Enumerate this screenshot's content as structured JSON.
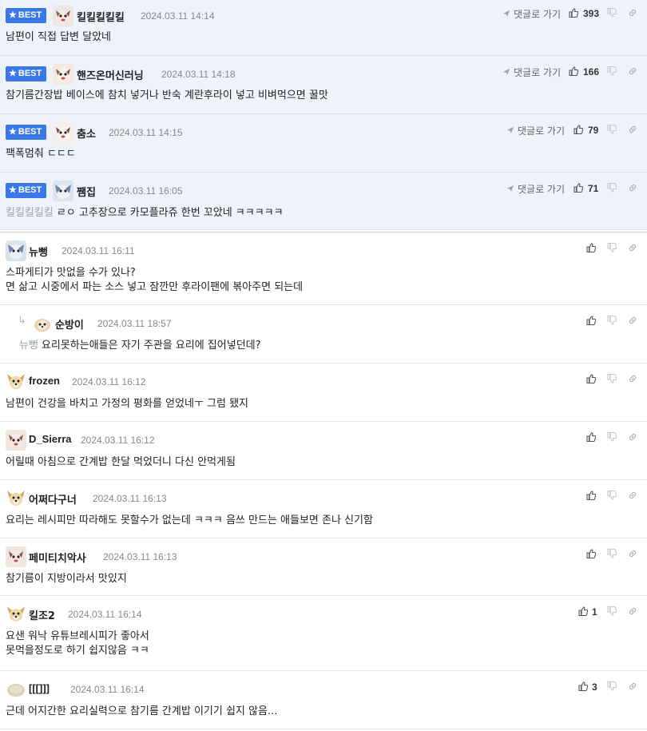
{
  "best_label": "BEST",
  "reply_to_label": "댓글로 가기",
  "best": [
    {
      "nick": "킬킬킬킬킬",
      "date": "2024.03.11 14:14",
      "likes": "393",
      "text": "남편이 직접 답변 달았네",
      "mention": ""
    },
    {
      "nick": "핸즈온머신러닝",
      "date": "2024.03.11 14:18",
      "likes": "166",
      "text": "참기름간장밥 베이스에 참치 넣거나 반숙 계란후라이 넣고 비벼먹으면 꿀맛",
      "mention": ""
    },
    {
      "nick": "춤소",
      "date": "2024.03.11 14:15",
      "likes": "79",
      "text": "팩폭멈춰 ㄷㄷㄷ",
      "mention": ""
    },
    {
      "nick": "쨈집",
      "date": "2024.03.11 16:05",
      "likes": "71",
      "text": "ㄹㅇ 고추장으로 카모플라쥬 한번 꼬았네 ㅋㅋㅋㅋㅋ",
      "mention": "킬킬킬킬킬"
    }
  ],
  "comments": [
    {
      "nick": "뉴뻥",
      "date": "2024.03.11 16:11",
      "likes": "",
      "lines": [
        "스파게티가 맛없을 수가 있나?",
        "면 삶고 시중에서 파는 소스 넣고 잠깐만 후라이팬에 볶아주면 되는데"
      ],
      "mention": ""
    },
    {
      "nick": "순방이",
      "date": "2024.03.11 18:57",
      "likes": "",
      "lines": [
        "요리못하는애들은 자기 주관을 요리에 집어넣던데?"
      ],
      "mention": "뉴뻥"
    },
    {
      "nick": "frozen",
      "date": "2024.03.11 16:12",
      "likes": "",
      "lines": [
        "남편이 건강을 바치고 가정의 평화를 얻었네ㅜ 그럼 됐지"
      ],
      "mention": ""
    },
    {
      "nick": "D_Sierra",
      "date": "2024.03.11 16:12",
      "likes": "",
      "lines": [
        "어릴때 아침으로 간계밥 한달 먹었더니 다신 안먹게됨"
      ],
      "mention": ""
    },
    {
      "nick": "어쩌다구너",
      "date": "2024.03.11 16:13",
      "likes": "",
      "lines": [
        "요리는 레시피만 따라해도 못할수가 없는데 ㅋㅋㅋ 음쓰 만드는 애들보면 존나 신기함"
      ],
      "mention": ""
    },
    {
      "nick": "페미티치악사",
      "date": "2024.03.11 16:13",
      "likes": "",
      "lines": [
        "참기름이 지방이라서 맛있지"
      ],
      "mention": ""
    },
    {
      "nick": "킬조2",
      "date": "2024.03.11 16:14",
      "likes": "1",
      "lines": [
        "요샌 워낙 유튜브레시피가 좋아서",
        "못먹을정도로 하기 쉽지않음 ㅋㅋ"
      ],
      "mention": ""
    },
    {
      "nick": "[[[]]]",
      "date": "2024.03.11 16:14",
      "likes": "3",
      "lines": [
        "근데 어지간한 요리실력으로 참기름 간계밥 이기기 쉽지 않음..."
      ],
      "mention": ""
    }
  ],
  "colors": {
    "best_bg": "#eef3fb",
    "badge": "#3b78e7",
    "date": "#888888",
    "border": "#e6e6e6"
  },
  "icons": [
    "star-icon",
    "reply-arrow-icon",
    "thumbs-up-icon",
    "thumbs-down-icon",
    "link-icon",
    "avatar-icon"
  ]
}
